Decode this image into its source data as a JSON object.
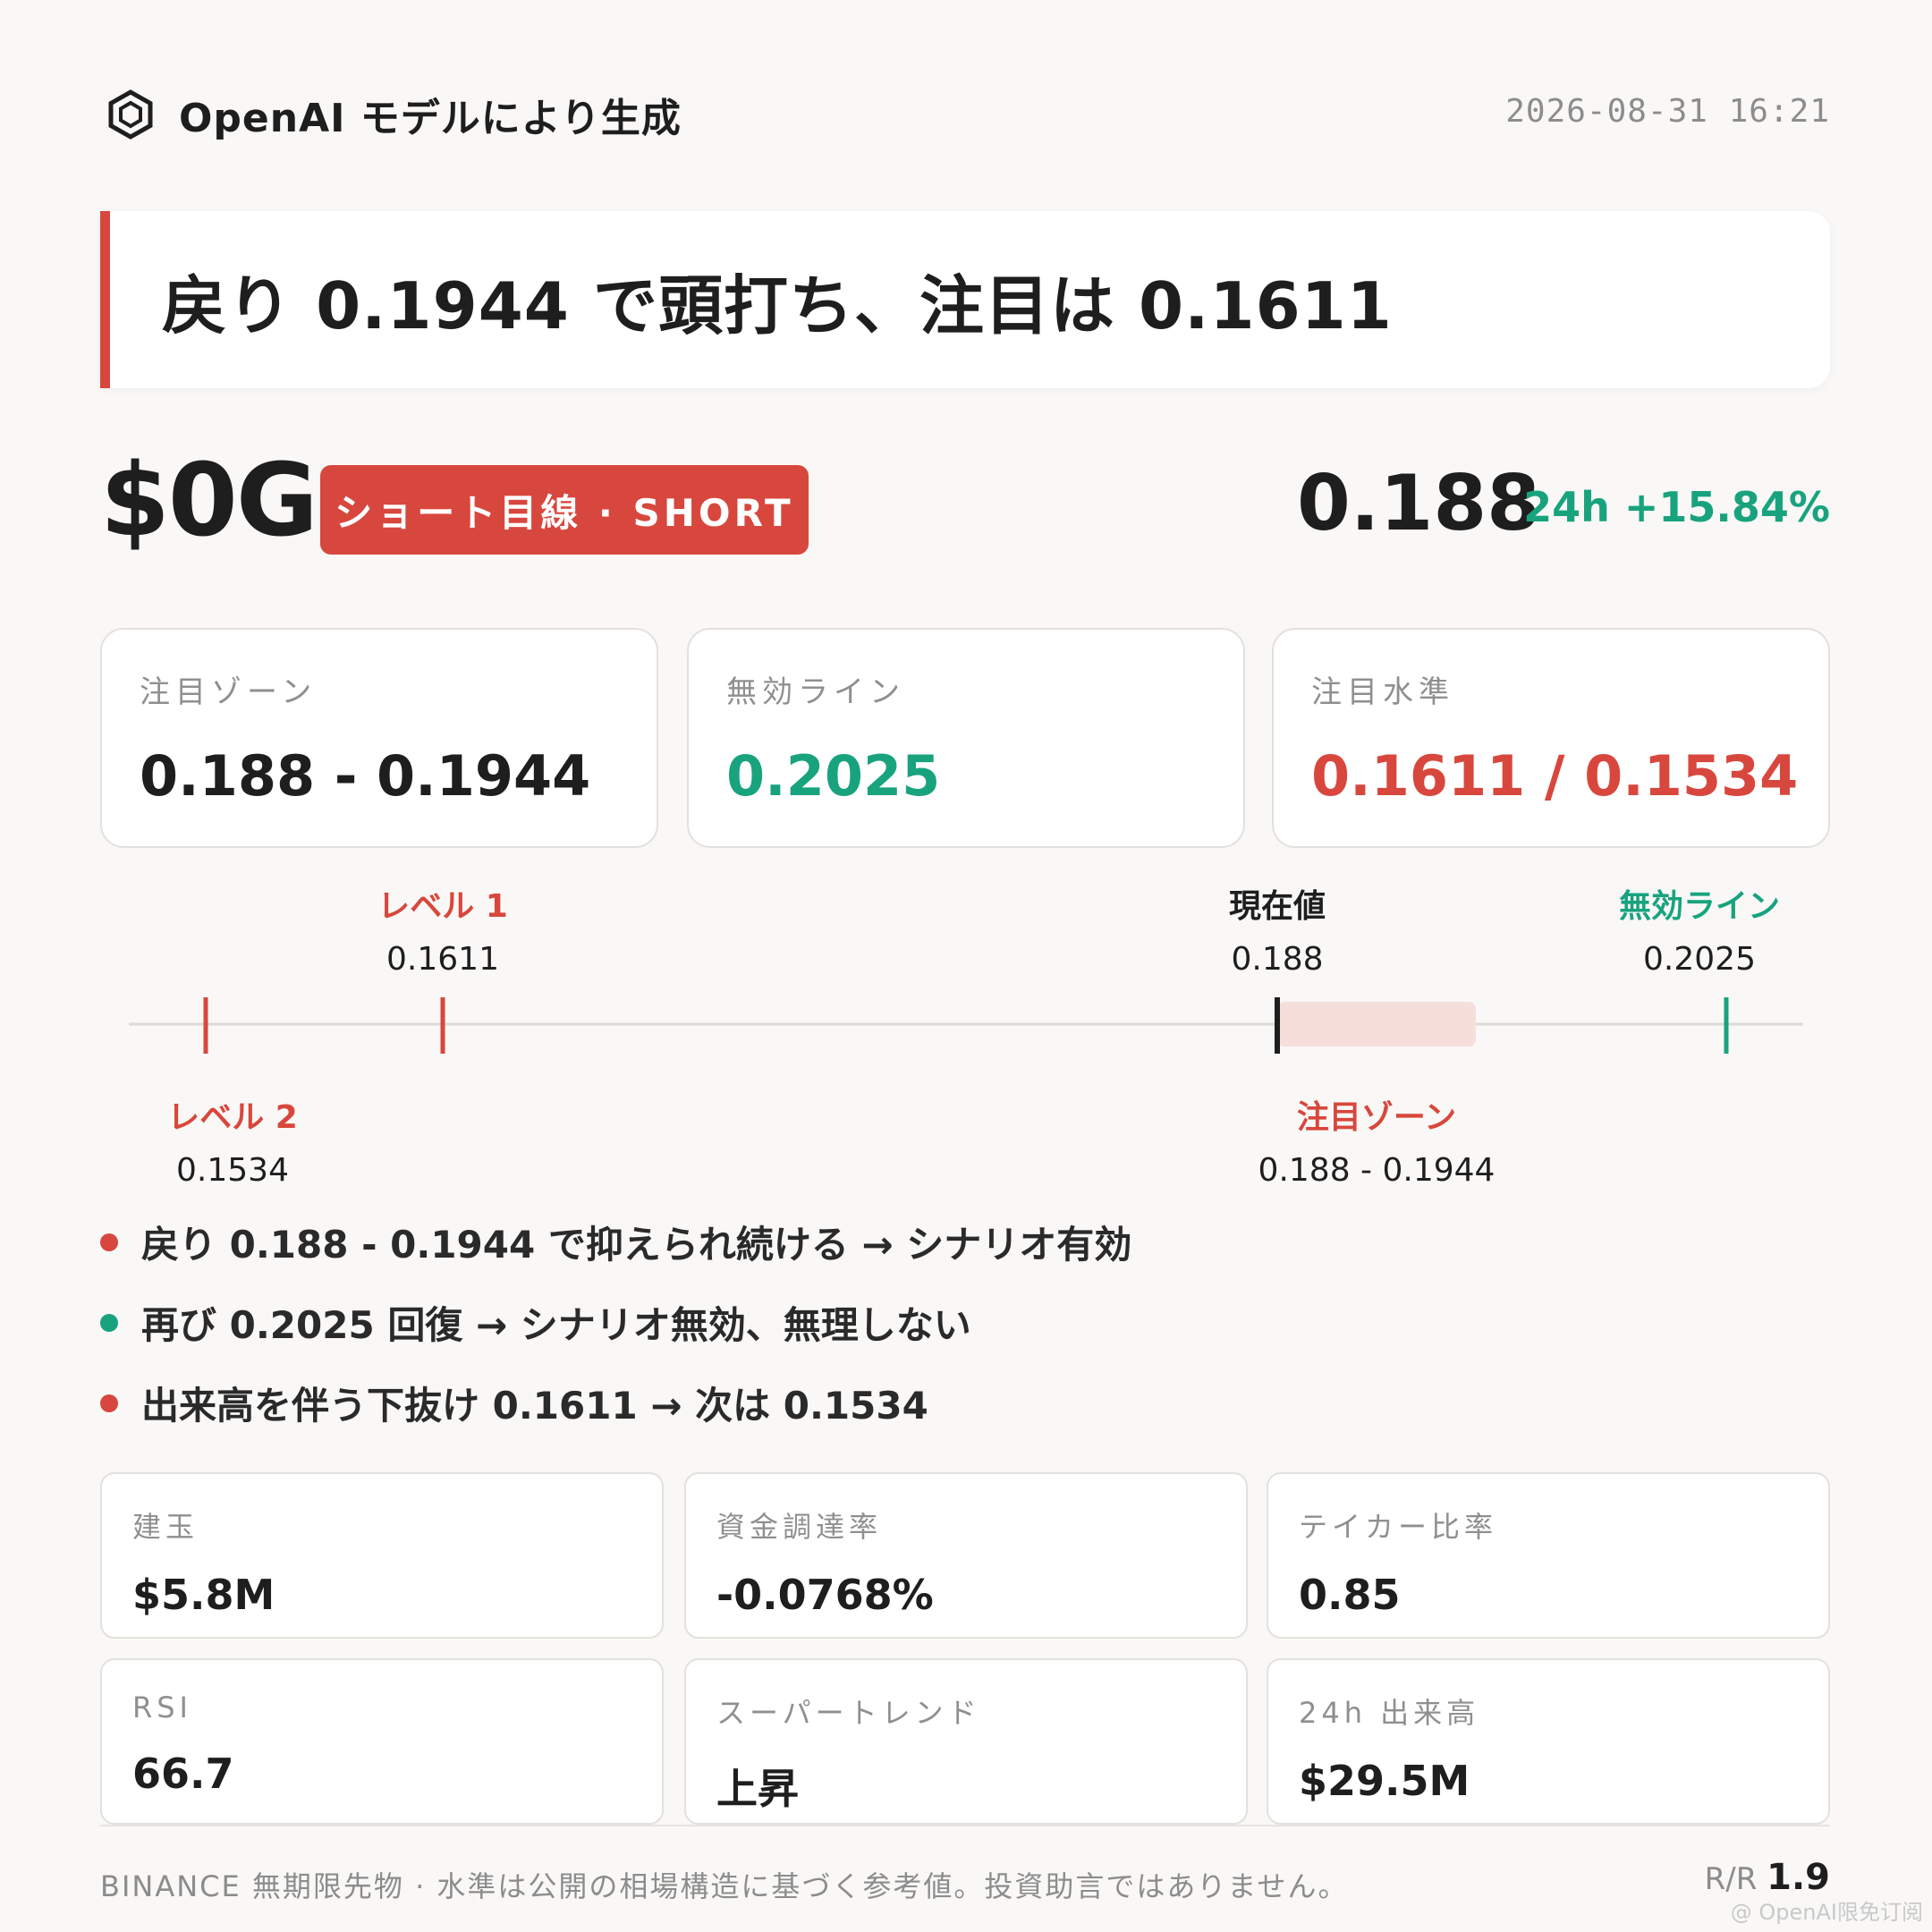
{
  "header": {
    "brand_icon": "hexagon-logo-icon",
    "brand_text": "OpenAI モデルにより生成",
    "timestamp": "2026-08-31 16:21"
  },
  "headline": "戻り 0.1944 で頭打ち、注目は 0.1611",
  "ticker": {
    "symbol": "$0G",
    "badge": "ショート目線 · SHORT",
    "price": "0.188",
    "change": "24h +15.84%"
  },
  "level_cards": [
    {
      "label": "注目ゾーン",
      "value": "0.188 - 0.1944",
      "color": "#1e1e1e"
    },
    {
      "label": "無効ライン",
      "value": "0.2025",
      "color": "#18a37e"
    },
    {
      "label": "注目水準",
      "value": "0.1611 / 0.1534",
      "color": "#d8473d"
    }
  ],
  "ruler": {
    "level1": {
      "title": "レベル 1",
      "value": "0.1611"
    },
    "level2": {
      "title": "レベル 2",
      "value": "0.1534"
    },
    "current": {
      "title": "現在値",
      "value": "0.188"
    },
    "invalid": {
      "title": "無効ライン",
      "value": "0.2025"
    },
    "zone": {
      "title": "注目ゾーン",
      "value": "0.188 - 0.1944"
    }
  },
  "bullets": [
    {
      "text": "戻り 0.188 - 0.1944 で抑えられ続ける → シナリオ有効",
      "color": "#d8473d"
    },
    {
      "text": "再び 0.2025 回復 → シナリオ無効、無理しない",
      "color": "#18a37e"
    },
    {
      "text": "出来高を伴う下抜け 0.1611 → 次は 0.1534",
      "color": "#d8473d"
    }
  ],
  "metrics": [
    {
      "label": "建玉",
      "value": "$5.8M"
    },
    {
      "label": "資金調達率",
      "value": "-0.0768%"
    },
    {
      "label": "テイカー比率",
      "value": "0.85"
    },
    {
      "label": "RSI",
      "value": "66.7"
    },
    {
      "label": "スーパートレンド",
      "value": "上昇"
    },
    {
      "label": "24h 出来高",
      "value": "$29.5M"
    }
  ],
  "footer": {
    "disclaimer": "BINANCE 無期限先物 · 水準は公開の相場構造に基づく参考値。投資助言ではありません。",
    "rr_label": "R/R",
    "rr_value": "1.9",
    "watermark": "@ OpenAI限免订阅"
  },
  "colors": {
    "red": "#d8473d",
    "green": "#18a37e",
    "background": "#f9f8f6"
  }
}
